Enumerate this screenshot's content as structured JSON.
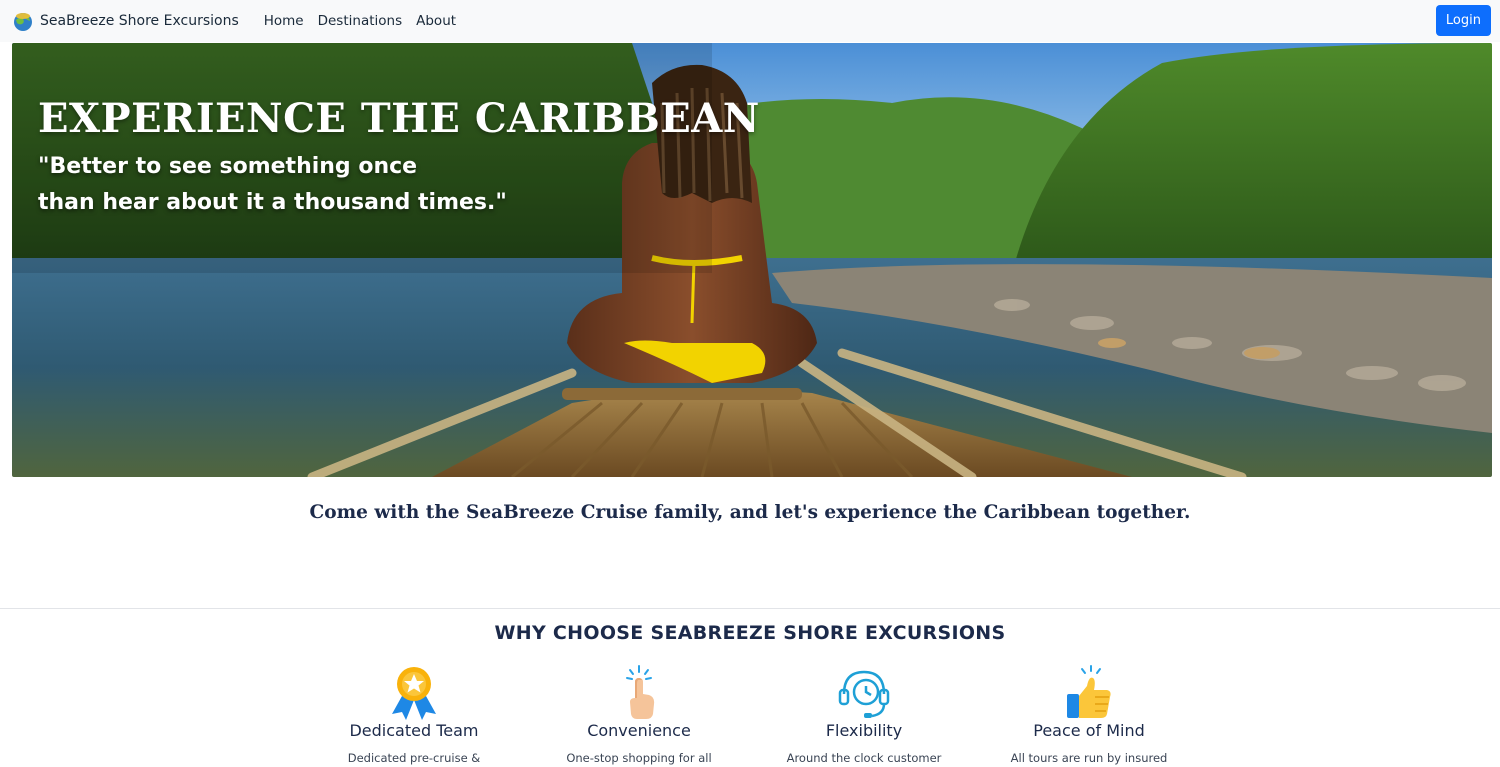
{
  "navbar": {
    "brand": "SeaBreeze Shore Excursions",
    "links": [
      "Home",
      "Destinations",
      "About"
    ],
    "login_label": "Login"
  },
  "hero": {
    "title": "EXPERIENCE THE CARIBBEAN",
    "quote_line1": "\"Better to see something once",
    "quote_line2": "than hear about it a thousand times.\""
  },
  "tagline": "Come with the SeaBreeze Cruise family, and let's experience the Caribbean together.",
  "why": {
    "title": "WHY CHOOSE SEABREEZE SHORE EXCURSIONS",
    "features": [
      {
        "icon": "award-ribbon-icon",
        "title": "Dedicated Team",
        "desc": "Dedicated pre-cruise &"
      },
      {
        "icon": "pointing-hand-icon",
        "title": "Convenience",
        "desc": "One-stop shopping for all"
      },
      {
        "icon": "support-headset-icon",
        "title": "Flexibility",
        "desc": "Around the clock customer"
      },
      {
        "icon": "thumbs-up-icon",
        "title": "Peace of Mind",
        "desc": "All tours are run by insured"
      }
    ]
  },
  "colors": {
    "primary": "#0d6efd",
    "navy": "#1c2a4a",
    "navbar_bg": "#f8f9fa"
  }
}
